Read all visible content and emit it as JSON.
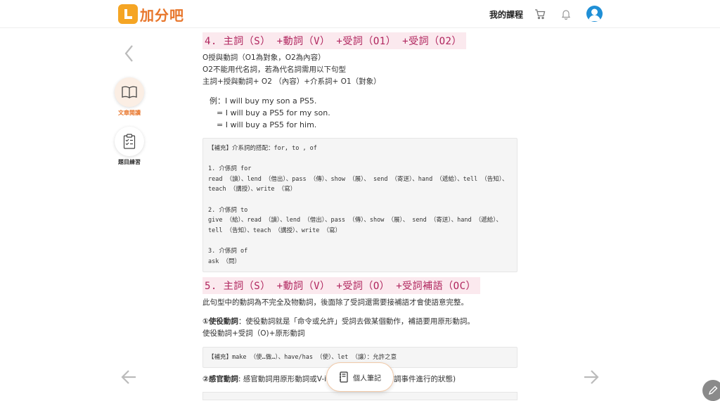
{
  "header": {
    "logo_text": "加分吧",
    "my_courses": "我的課程",
    "icons": [
      "cart-icon",
      "bell-icon",
      "avatar"
    ]
  },
  "sidebar": {
    "items": [
      {
        "label": "文章閱讀",
        "icon": "book-icon",
        "active": true
      },
      {
        "label": "題目練習",
        "icon": "clipboard-icon",
        "active": false
      }
    ]
  },
  "article": {
    "section4": {
      "title": "4. 主詞（S） +動詞（V） +受詞（O1） +受詞（O2）",
      "lines": [
        "O授與動詞（O1為對象，O2為內容）",
        "O2不能用代名詞，若為代名詞需用以下句型",
        "主詞+授與動詞+ O2 （內容）+介系詞+ O1（對象）"
      ],
      "example_lines": [
        "例：I will buy my son a PS5.",
        "= I will buy a PS5 for my son.",
        "= I will buy a PS5 for him."
      ],
      "supplement": "【補充】介系詞的搭配：for, to , of\n\n1. 介係詞 for\nread （讀）、lend （借出）、pass （傳）、show （展）、 send （寄送）、hand （遞給）、tell （告知）、teach （講授）、write （寫）\n\n2. 介係詞 to\ngive （給）、read （讀）、lend （借出）、pass （傳）、show （展）、 send （寄送）、hand （遞給）、tell （告知）、teach （講授）、write （寫）\n\n3. 介係詞 of\nask （問）"
    },
    "section5": {
      "title": "5. 主詞（S） +動詞（V） +受詞（O） +受詞補語（OC）",
      "intro": "此句型中的動詞為不完全及物動詞，後面除了受詞還需要接補語才會使語意完整。",
      "causative_label": "①使役動詞",
      "causative_text": "：使役動詞就是「命令或允許」受詞去做某個動作，補語要用原形動詞。",
      "causative_pattern": "使役動詞+受詞（O)+原形動詞",
      "supplement2": "【補充】make （使…做…）、have/has （使）、let （讓）：允許之意",
      "perception_label": "②感官動詞",
      "perception_text": ": 感官動詞用原形動詞或V-i",
      "perception_tail": "調事件進行的狀態)"
    }
  },
  "notes_button": "個人筆記",
  "colors": {
    "brand_orange": "#f5a524",
    "title_bg": "#fbe9ee",
    "title_text": "#b0255e",
    "avatar_blue": "#1f8fd6"
  }
}
